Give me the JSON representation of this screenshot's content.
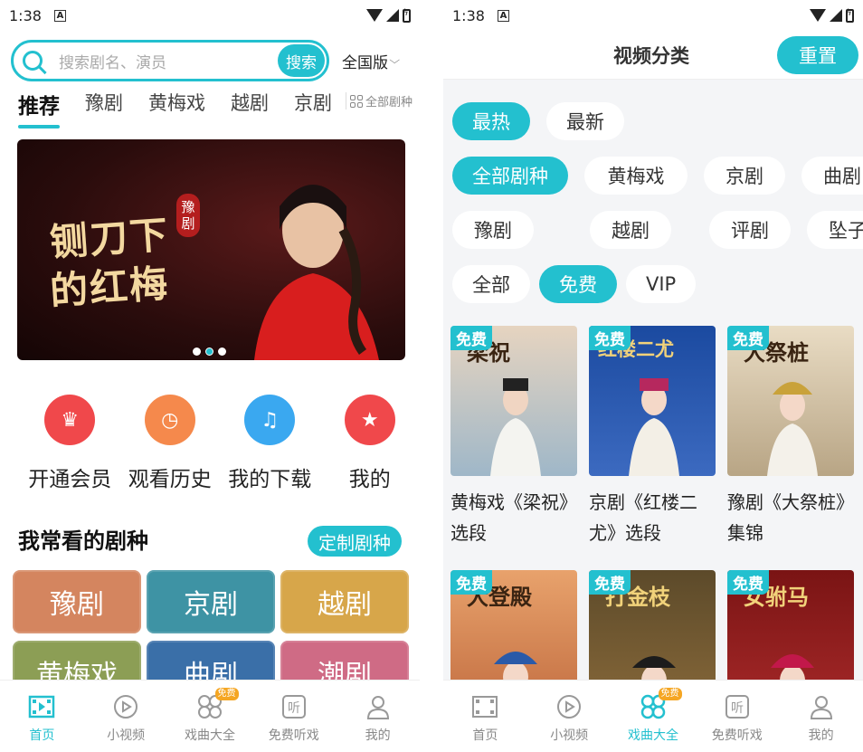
{
  "left": {
    "status": {
      "time": "1:38",
      "a_icon": "A"
    },
    "search": {
      "placeholder": "搜索剧名、演员",
      "button": "搜索",
      "region": "全国版"
    },
    "tabs": [
      "推荐",
      "豫剧",
      "黄梅戏",
      "越剧",
      "京剧"
    ],
    "all_tabs": "全部剧种",
    "banner": {
      "line1": "铡刀下",
      "line2": "的红梅",
      "seal_top": "豫",
      "seal_bottom": "剧"
    },
    "quick": [
      {
        "label": "开通会员",
        "icon": "vip-icon",
        "color": "#f0484b"
      },
      {
        "label": "观看历史",
        "icon": "history-icon",
        "color": "#f5894c"
      },
      {
        "label": "我的下载",
        "icon": "download-icon",
        "color": "#3aa8f0"
      },
      {
        "label": "我的",
        "icon": "more-icon",
        "color": "#f0484b"
      }
    ],
    "section": {
      "title": "我常看的剧种",
      "button": "定制剧种"
    },
    "genres": [
      {
        "label": "豫剧",
        "color": "#d4855f"
      },
      {
        "label": "京剧",
        "color": "#3e93a4"
      },
      {
        "label": "越剧",
        "color": "#d7a64a"
      },
      {
        "label": "黄梅戏",
        "color": "#8c9e55"
      },
      {
        "label": "曲剧",
        "color": "#3a6fa8"
      },
      {
        "label": "潮剧",
        "color": "#cf6b85"
      }
    ],
    "nav": [
      {
        "label": "首页",
        "icon": "film-icon",
        "active": true
      },
      {
        "label": "小视频",
        "icon": "play-icon",
        "active": false
      },
      {
        "label": "戏曲大全",
        "icon": "clover-icon",
        "active": false,
        "badge": "免费"
      },
      {
        "label": "免费听戏",
        "icon": "listen-icon",
        "active": false
      },
      {
        "label": "我的",
        "icon": "user-icon",
        "active": false
      }
    ]
  },
  "right": {
    "status": {
      "time": "1:38",
      "a_icon": "A"
    },
    "header": {
      "title": "视频分类",
      "reset": "重置"
    },
    "sort": [
      "最热",
      "最新"
    ],
    "genres_row1": [
      "全部剧种",
      "黄梅戏",
      "京剧",
      "曲剧"
    ],
    "genres_row2": [
      "豫剧",
      "越剧",
      "评剧",
      "坠子"
    ],
    "price": [
      "全部",
      "免费",
      "VIP"
    ],
    "cards": [
      {
        "badge": "免费",
        "thumb_title": "梁祝",
        "title": "黄梅戏《梁祝》选段",
        "bg": "#d9e3ea"
      },
      {
        "badge": "免费",
        "thumb_title": "红楼二尤",
        "title": "京剧《红楼二尤》选段",
        "bg": "#2b57a8"
      },
      {
        "badge": "免费",
        "thumb_title": "大祭桩",
        "title": "豫剧《大祭桩》集锦",
        "bg": "#c9b89a"
      },
      {
        "badge": "免费",
        "thumb_title": "大登殿",
        "title": "",
        "bg": "#d98a5a"
      },
      {
        "badge": "免费",
        "thumb_title": "打金枝",
        "title": "",
        "bg": "#6b5a3a"
      },
      {
        "badge": "免费",
        "thumb_title": "女驸马",
        "title": "",
        "bg": "#8a1f1f"
      }
    ],
    "nav": [
      {
        "label": "首页",
        "icon": "film-icon",
        "active": false
      },
      {
        "label": "小视频",
        "icon": "play-icon",
        "active": false
      },
      {
        "label": "戏曲大全",
        "icon": "clover-icon",
        "active": true,
        "badge": "免费"
      },
      {
        "label": "免费听戏",
        "icon": "listen-icon",
        "active": false
      },
      {
        "label": "我的",
        "icon": "user-icon",
        "active": false
      }
    ]
  },
  "colors": {
    "accent": "#23c0cf"
  }
}
